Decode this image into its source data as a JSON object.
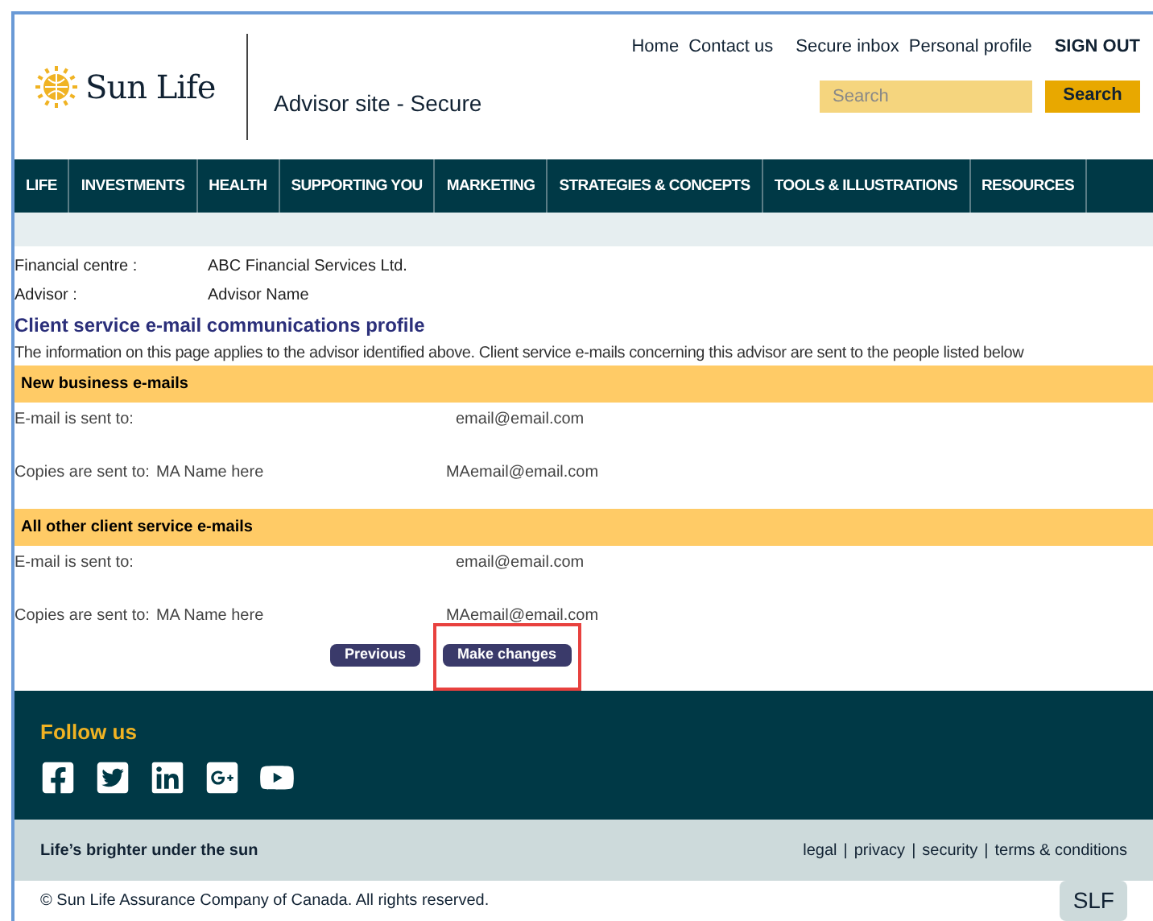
{
  "header": {
    "logo": "Sun Life",
    "site_title": "Advisor site - Secure",
    "top_links": [
      "Home",
      "Contact us",
      "Secure inbox",
      "Personal profile"
    ],
    "sign_out": "SIGN OUT",
    "search": {
      "placeholder": "Search",
      "button": "Search"
    }
  },
  "nav": [
    "LIFE",
    "INVESTMENTS",
    "HEALTH",
    "SUPPORTING YOU",
    "MARKETING",
    "STRATEGIES & CONCEPTS",
    "TOOLS & ILLUSTRATIONS",
    "RESOURCES"
  ],
  "info": [
    {
      "label": "Financial centre :",
      "value": "ABC Financial Services Ltd."
    },
    {
      "label": "Advisor :",
      "value": "Advisor Name"
    }
  ],
  "title": "Client service e-mail communications profile",
  "description": "The information on this page applies to the advisor identified above. Client service e-mails concerning this advisor are sent to the people listed below",
  "sections": [
    {
      "heading": "New business e-mails",
      "sent_label": "E-mail is sent to:",
      "sent_email": "email@email.com",
      "copies_label": "Copies are sent to:",
      "copies_name": "MA Name here",
      "copies_email": "MAemail@email.com"
    },
    {
      "heading": "All other client service e-mails",
      "sent_label": "E-mail is sent to:",
      "sent_email": "email@email.com",
      "copies_label": "Copies are sent to:",
      "copies_name": "MA Name here",
      "copies_email": "MAemail@email.com"
    }
  ],
  "buttons": [
    {
      "label": "Previous",
      "highlighted": false
    },
    {
      "label": "Make changes",
      "highlighted": true
    }
  ],
  "footer": {
    "follow": "Follow us",
    "social": [
      {
        "kind": "facebook"
      },
      {
        "kind": "twitter"
      },
      {
        "kind": "linkedin"
      },
      {
        "kind": "googleplus"
      },
      {
        "kind": "youtube"
      }
    ],
    "tagline": "Life’s brighter under the sun",
    "links": [
      "legal",
      "privacy",
      "security",
      "terms & conditions"
    ],
    "separator": "|",
    "copyright": "© Sun Life Assurance Company of Canada. All rights reserved.",
    "badge": "SLF"
  }
}
